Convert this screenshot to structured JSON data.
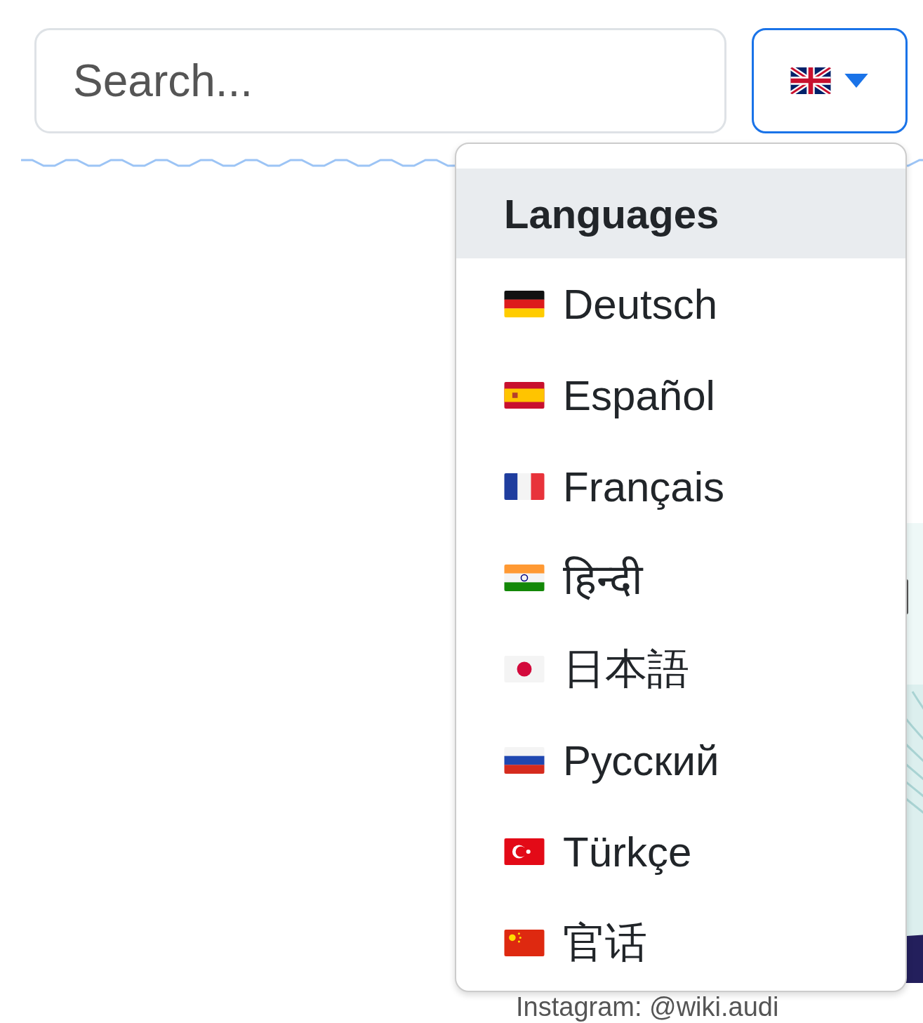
{
  "search": {
    "placeholder": "Search..."
  },
  "language_button": {
    "expanded": true
  },
  "language_menu": {
    "header": "Languages",
    "items": [
      {
        "label": "Deutsch"
      },
      {
        "label": "Español"
      },
      {
        "label": "Français"
      },
      {
        "label": "हिन्दी"
      },
      {
        "label": "日本語"
      },
      {
        "label": "Русский"
      },
      {
        "label": "Türkçe"
      },
      {
        "label": "官话"
      }
    ]
  },
  "content": {
    "caption": "Instagram: @wiki.audi"
  }
}
